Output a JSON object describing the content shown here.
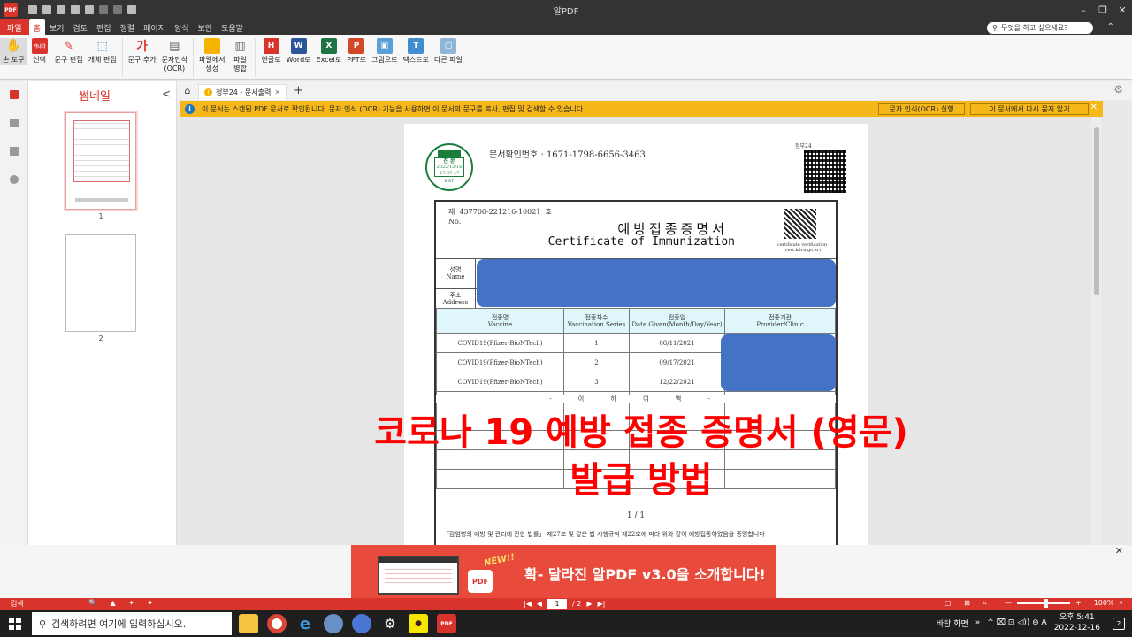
{
  "window": {
    "title": "알PDF",
    "minimize": "–",
    "restore": "❐",
    "close": "✕"
  },
  "app_logo": "PDF",
  "menu": {
    "file": "파일",
    "items": [
      "홈",
      "보기",
      "검토",
      "편집",
      "정렬",
      "페이지",
      "양식",
      "보안",
      "도움말"
    ],
    "help_placeholder": "무엇을 하고 싶으세요?"
  },
  "ribbon": {
    "hand_tool": "손 도구",
    "select": "선택",
    "text_edit": "문구 편집",
    "object_edit": "개체 편집",
    "add_text": "문구 추가",
    "ocr_line1": "문자인식",
    "ocr_line2": "(OCR)",
    "create_line1": "파일에서",
    "create_line2": "생성",
    "merge_line1": "파일",
    "merge_line2": "병합",
    "to_hwp": "한글로",
    "to_word": "Word로",
    "to_excel": "Excel로",
    "to_ppt": "PPT로",
    "to_image": "그림으로",
    "to_text": "텍스트로",
    "to_other": "다른 파일",
    "add_text_glyph": "가",
    "select_glyph": "가나다",
    "hwp_glyph": "H",
    "word_glyph": "W",
    "excel_glyph": "X",
    "ppt_glyph": "P",
    "text_glyph": "T"
  },
  "thumbnails": {
    "title": "썸네일",
    "collapse": "<",
    "page1": "1",
    "page2": "2"
  },
  "tabs": {
    "home": "⌂",
    "doc_tab": "정부24 - 문서출력",
    "doc_close": "✕",
    "add": "+",
    "settings": "⚙"
  },
  "infobar": {
    "message": "이 문서는 스캔된 PDF 문서로 확인됩니다. 문자 인식 (OCR) 기능을 사용하면 이 문서의 문구를 복사, 편집 및 검색할 수 있습니다.",
    "ocr_button": "문자 인식(OCR) 실행",
    "dont_ask_button": "이 문서에서 다시 묻지 않기",
    "close": "✕",
    "icon": "i"
  },
  "document": {
    "doc_check_label": "문서확인번호 :",
    "doc_check_number": "1671-1798-6656-3463",
    "seal_top": "진 본",
    "seal_date": "2022/12/16",
    "seal_time": "17:37:47",
    "seal_zone": "KST",
    "gov_mark": "정부24",
    "cert_no_prefix": "제",
    "cert_no": "437700-221216-10021",
    "cert_no_suffix": "호",
    "cert_no_en": "No.",
    "title_ko": "예방접종증명서",
    "title_en": "Certificate of Immunization",
    "verify_line1": "certificate verification",
    "verify_line2": "(cert.kdca.go.kr)",
    "name_ko": "성명",
    "name_en": "Name",
    "addr_ko": "주소",
    "addr_en": "Address",
    "headers": [
      {
        "ko": "접종명",
        "en": "Vaccine"
      },
      {
        "ko": "접종차수",
        "en": "Vaccination Series"
      },
      {
        "ko": "접종일",
        "en": "Date Given(Month/Day/Year)"
      },
      {
        "ko": "접종기관",
        "en": "Provider/Clinic"
      }
    ],
    "rows": [
      {
        "vaccine": "COVID19(Pfizer-BioNTech)",
        "series": "1",
        "date": "08/11/2021"
      },
      {
        "vaccine": "COVID19(Pfizer-BioNTech)",
        "series": "2",
        "date": "09/17/2021"
      },
      {
        "vaccine": "COVID19(Pfizer-BioNTech)",
        "series": "3",
        "date": "12/22/2021"
      }
    ],
    "blank_mark": "- 이 하 여 백 -",
    "page_count": "1 / 1",
    "footnote": "「감염병의 예방 및 관리에 관한 법률」 제27조 및 같은 법 시행규칙 제22호에 따라 위와 같이 예방접종하였음을 증명합니다"
  },
  "overlay": {
    "line1": "코로나 19 예방 접종 증명서 (영문)",
    "line2": "발급 방법"
  },
  "banner": {
    "new": "NEW!!",
    "pdf": "PDF",
    "text": "확- 달라진 알PDF v3.0을 소개합니다!",
    "close": "✕"
  },
  "statusbar": {
    "search": "검색",
    "tools": "🔍 ▲ ✦ ✦",
    "first": "|◀",
    "prev": "◀",
    "current_page": "1",
    "total": "/ 2",
    "next": "▶",
    "last": "▶|",
    "views": "▢ ⊠ ⌗",
    "zoom_out": "—",
    "zoom_in": "+",
    "zoom": "100%",
    "zoom_fraction": 0.55,
    "zoom_menu": "▾"
  },
  "taskbar": {
    "search_placeholder": "검색하려면 여기에 입력하십시오.",
    "search_icon": "⚲",
    "desktop": "바탕 화면",
    "tray_more": "»",
    "tray_icons": "^ ⌧ ⊡ ◁)) ⊖ A",
    "time": "오후 5:41",
    "date": "2022-12-16",
    "notify": "2"
  },
  "colors": {
    "accent": "#d9342b",
    "infobar": "#f6b71a",
    "redact": "#4472c4",
    "overlay": "#ff0000"
  }
}
